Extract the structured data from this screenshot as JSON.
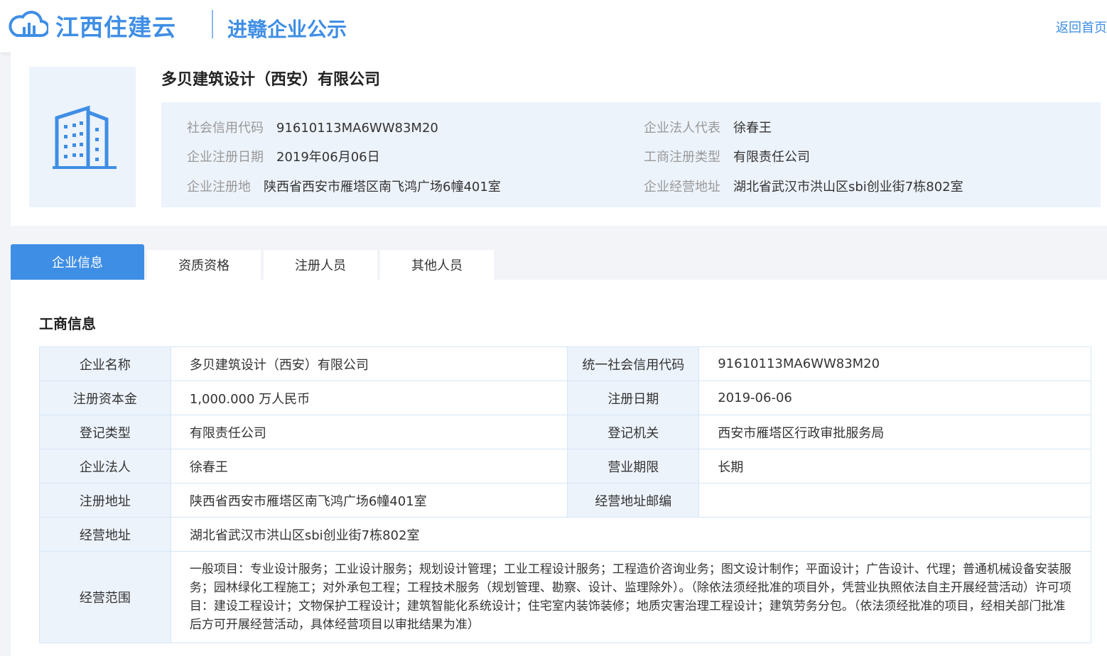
{
  "header": {
    "brand": "江西住建云",
    "subtitle": "进赣企业公示",
    "back_link": "返回首页",
    "accent": "#3f8ee5"
  },
  "company": {
    "name": "多贝建筑设计（西安）有限公司",
    "logo_icon": "building-icon",
    "info": [
      {
        "label": "社会信用代码",
        "value": "91610113MA6WW83M20"
      },
      {
        "label": "企业法人代表",
        "value": "徐春王"
      },
      {
        "label": "企业注册日期",
        "value": "2019年06月06日"
      },
      {
        "label": "工商注册类型",
        "value": "有限责任公司"
      },
      {
        "label": "企业注册地",
        "value": "陕西省西安市雁塔区南飞鸿广场6幢401室"
      },
      {
        "label": "企业经营地址",
        "value": "湖北省武汉市洪山区sbi创业街7栋802室"
      }
    ]
  },
  "tabs": [
    {
      "label": "企业信息",
      "active": true
    },
    {
      "label": "资质资格",
      "active": false
    },
    {
      "label": "注册人员",
      "active": false
    },
    {
      "label": "其他人员",
      "active": false
    }
  ],
  "section": {
    "title": "工商信息",
    "rows": [
      {
        "l1": "企业名称",
        "v1": "多贝建筑设计（西安）有限公司",
        "l2": "统一社会信用代码",
        "v2": "91610113MA6WW83M20"
      },
      {
        "l1": "注册资本金",
        "v1": "1,000.000 万人民币",
        "l2": "注册日期",
        "v2": "2019-06-06"
      },
      {
        "l1": "登记类型",
        "v1": "有限责任公司",
        "l2": "登记机关",
        "v2": "西安市雁塔区行政审批服务局"
      },
      {
        "l1": "企业法人",
        "v1": "徐春王",
        "l2": "营业期限",
        "v2": "长期"
      },
      {
        "l1": "注册地址",
        "v1": "陕西省西安市雁塔区南飞鸿广场6幢401室",
        "l2": "经营地址邮编",
        "v2": ""
      }
    ],
    "address_label": "经营地址",
    "address_value": "湖北省武汉市洪山区sbi创业街7栋802室",
    "scope_label": "经营范围",
    "scope_value": "一般项目：专业设计服务；工业设计服务；规划设计管理；工业工程设计服务；工程造价咨询业务；图文设计制作；平面设计；广告设计、代理；普通机械设备安装服务；园林绿化工程施工；对外承包工程；工程技术服务（规划管理、勘察、设计、监理除外）。（除依法须经批准的项目外，凭营业执照依法自主开展经营活动）许可项目：建设工程设计；文物保护工程设计；建筑智能化系统设计；住宅室内装饰装修；地质灾害治理工程设计；建筑劳务分包。（依法须经批准的项目，经相关部门批准后方可开展经营活动，具体经营项目以审批结果为准）"
  }
}
